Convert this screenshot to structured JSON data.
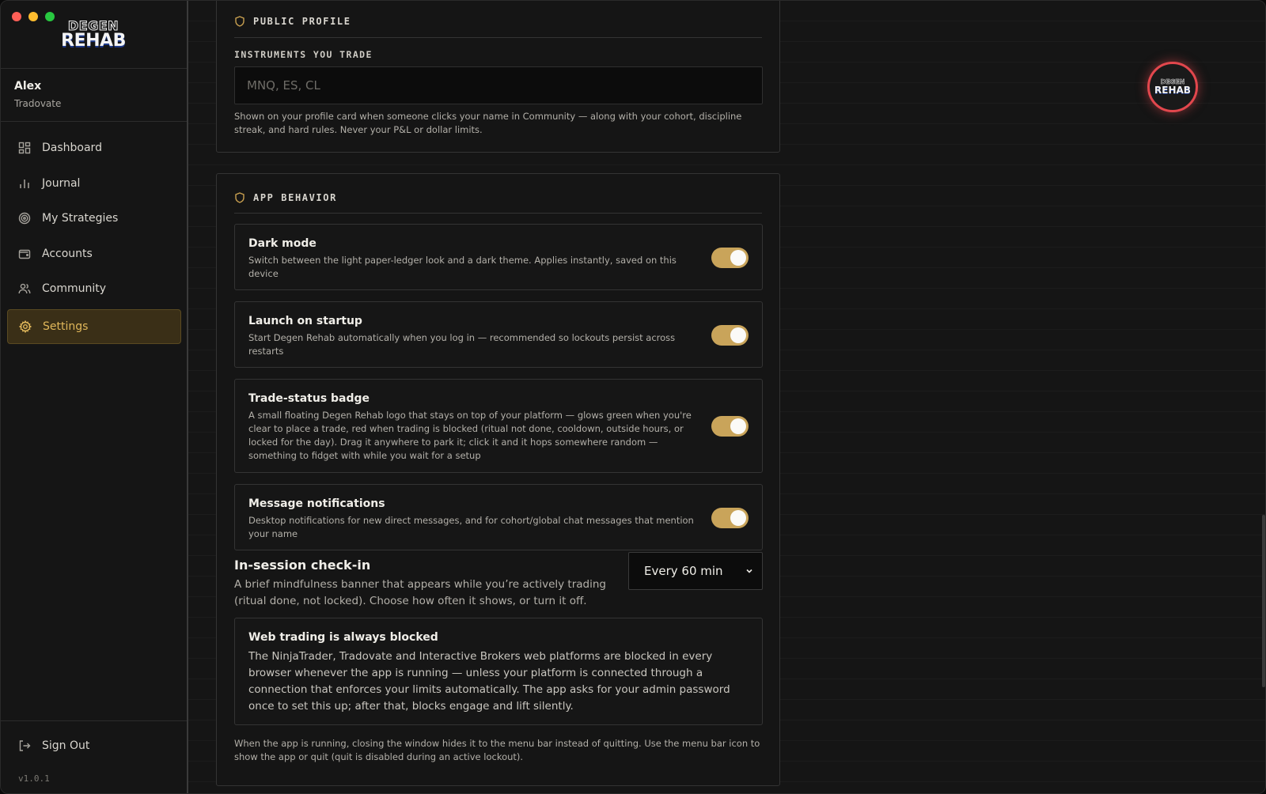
{
  "app": {
    "logo_top": "DEGEN",
    "logo_bottom": "REHAB",
    "version": "v1.0.1"
  },
  "user": {
    "name": "Alex",
    "broker": "Tradovate"
  },
  "nav": {
    "items": [
      {
        "label": "Dashboard",
        "icon": "grid-icon"
      },
      {
        "label": "Journal",
        "icon": "bar-chart-icon"
      },
      {
        "label": "My Strategies",
        "icon": "target-icon"
      },
      {
        "label": "Accounts",
        "icon": "wallet-icon"
      },
      {
        "label": "Community",
        "icon": "users-icon"
      },
      {
        "label": "Settings",
        "icon": "gear-icon",
        "active": true
      }
    ],
    "sign_out": "Sign Out"
  },
  "badge": {
    "top": "DEGEN",
    "bottom": "REHAB",
    "status_color": "#e2474d"
  },
  "public_profile": {
    "title": "PUBLIC PROFILE",
    "field_label": "INSTRUMENTS YOU TRADE",
    "placeholder": "MNQ, ES, CL",
    "value": "",
    "help": "Shown on your profile card when someone clicks your name in Community — along with your cohort, discipline streak, and hard rules. Never your P&L or dollar limits."
  },
  "app_behavior": {
    "title": "APP BEHAVIOR",
    "settings": [
      {
        "title": "Dark mode",
        "description": "Switch between the light paper-ledger look and a dark theme. Applies instantly, saved on this device",
        "enabled": true
      },
      {
        "title": "Launch on startup",
        "description": "Start Degen Rehab automatically when you log in — recommended so lockouts persist across restarts",
        "enabled": true
      },
      {
        "title": "Trade-status badge",
        "description": "A small floating Degen Rehab logo that stays on top of your platform — glows green when you're clear to place a trade, red when trading is blocked (ritual not done, cooldown, outside hours, or locked for the day). Drag it anywhere to park it; click it and it hops somewhere random — something to fidget with while you wait for a setup",
        "enabled": true
      },
      {
        "title": "Message notifications",
        "description": "Desktop notifications for new direct messages, and for cohort/global chat messages that mention your name",
        "enabled": true
      }
    ],
    "checkin": {
      "title": "In-session check-in",
      "description": "A brief mindfulness banner that appears while you’re actively trading (ritual done, not locked). Choose how often it shows, or turn it off.",
      "selected": "Every 60 min"
    },
    "web_trading": {
      "title": "Web trading is always blocked",
      "body": "The NinjaTrader, Tradovate and Interactive Brokers web platforms are blocked in every browser whenever the app is running — unless your platform is connected through a connection that enforces your limits automatically. The app asks for your admin password once to set this up; after that, blocks engage and lift silently."
    },
    "footer_note": "When the app is running, closing the window hides it to the menu bar instead of quitting. Use the menu bar icon to show the app or quit (quit is disabled during an active lockout)."
  },
  "colors": {
    "accent": "#c9a45a",
    "active_nav_bg": "#3a2f17",
    "active_nav_text": "#e0b75a"
  }
}
